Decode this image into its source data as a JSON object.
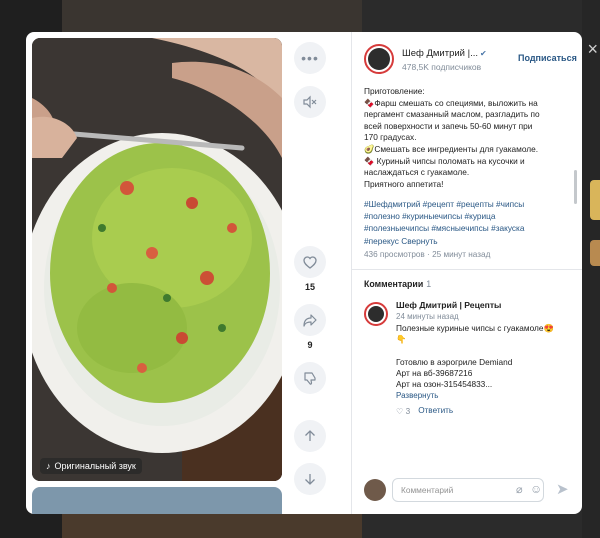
{
  "page": {
    "close_glyph": "×"
  },
  "video": {
    "sound_label": "Оригинальный звук",
    "sound_icon": "music-note-icon"
  },
  "actions": {
    "more_icon": "more-icon",
    "mute_icon": "volume-muted-icon",
    "like_icon": "heart-icon",
    "like_count": "15",
    "share_icon": "share-icon",
    "share_count": "9",
    "dislike_icon": "dislike-icon",
    "prev_icon": "arrow-up-icon",
    "next_icon": "arrow-down-icon"
  },
  "author": {
    "name": "Шеф Дмитрий |...",
    "verified": "✔",
    "subscribers": "478,5K подписчиков",
    "subscribe_label": "Подписаться"
  },
  "description": {
    "lines": [
      "Приготовление:",
      "🍫Фарш смешать со специями, выложить на",
      "пергамент смазанный маслом, разгладить по",
      "всей поверхности и запечь 50-60 минут при",
      "170 градусах.",
      "🥑Смешать все ингредиенты для гуакамоле.",
      "🍫 Куриный чипсы поломать на кусочки и",
      "наслаждаться с гуакамоле.",
      "Приятного аппетита!"
    ],
    "tag_lines": [
      "#Шефдмитрий #рецепт #рецепты #чипсы",
      "#полезно #куриныечипсы #курица",
      "#полезныечипсы #мясныечипсы #закуска"
    ],
    "tag_last": "#перекус",
    "collapse_label": "Свернуть",
    "views": "436 просмотров",
    "posted": "25 минут назад"
  },
  "comments": {
    "title": "Комментарии",
    "count": "1",
    "items": [
      {
        "author": "Шеф Дмитрий | Рецепты",
        "time": "24 минуты назад",
        "lines": [
          "Полезные куриные чипсы с гуакамоле😍",
          "👇",
          "",
          "Готовлю в аэрогриле Demiand",
          "Арт на вб-39687216",
          "Арт на озон-315454833..."
        ],
        "expand_label": "Развернуть",
        "likes": "3",
        "reply_label": "Ответить"
      }
    ]
  },
  "composer": {
    "placeholder": "Комментарий",
    "attach_icon": "paperclip-icon",
    "emoji_icon": "emoji-icon",
    "send_icon": "send-icon"
  },
  "colors": {
    "accent": "#2a5885",
    "muted": "#818c99",
    "avatar_ring": "#d63b3b"
  }
}
